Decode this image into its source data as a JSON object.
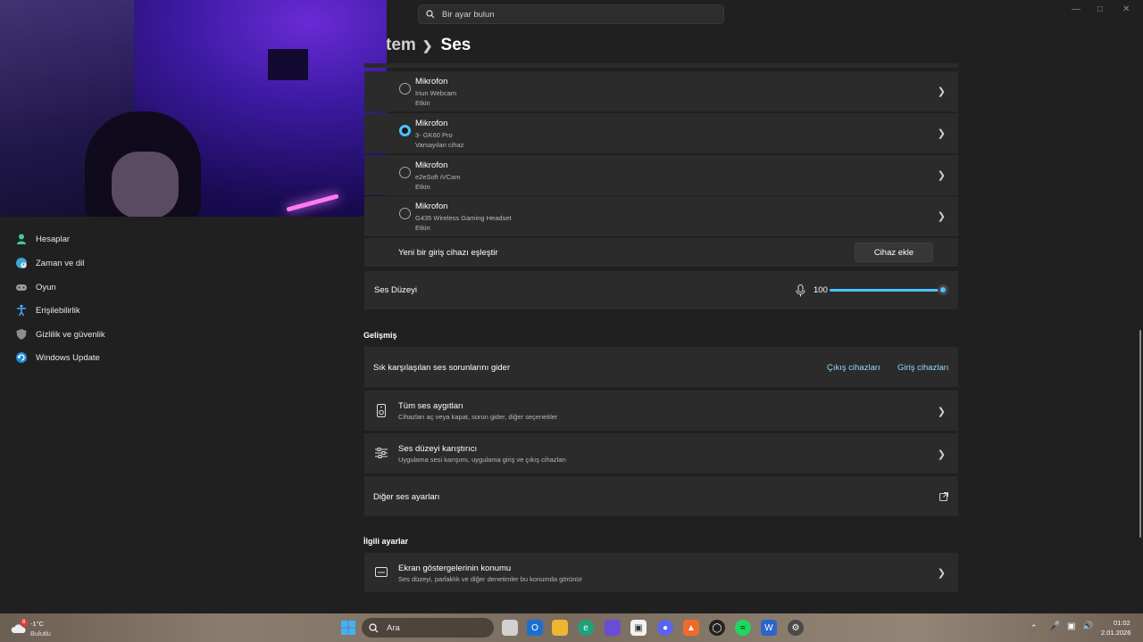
{
  "search": {
    "placeholder": "Bir ayar bulun"
  },
  "breadcrumb": {
    "parent": "tem",
    "current": "Ses"
  },
  "sidebar": {
    "items": [
      {
        "label": "Hesaplar",
        "icon": "account-icon"
      },
      {
        "label": "Zaman ve dil",
        "icon": "globe-clock-icon"
      },
      {
        "label": "Oyun",
        "icon": "gamepad-icon"
      },
      {
        "label": "Erişilebilirlik",
        "icon": "accessibility-icon"
      },
      {
        "label": "Gizlilik ve güvenlik",
        "icon": "shield-icon"
      },
      {
        "label": "Windows Update",
        "icon": "update-icon"
      }
    ]
  },
  "input_devices": [
    {
      "title": "Mikrofon",
      "device": "Iriun Webcam",
      "status": "Etkin",
      "selected": false
    },
    {
      "title": "Mikrofon",
      "device": "3- GK60 Pro",
      "status": "Varsayılan cihaz",
      "selected": true
    },
    {
      "title": "Mikrofon",
      "device": "e2eSoft iVCam",
      "status": "Etkin",
      "selected": false
    },
    {
      "title": "Mikrofon",
      "device": "G435 Wireless Gaming Headset",
      "status": "Etkin",
      "selected": false
    }
  ],
  "pair": {
    "label": "Yeni bir giriş cihazı eşleştir",
    "button": "Cihaz ekle"
  },
  "volume": {
    "label": "Ses Düzeyi",
    "value": "100",
    "level": 1.0
  },
  "advanced": {
    "title": "Gelişmiş",
    "troubleshoot": {
      "label": "Sık karşılaşılan ses sorunlarını gider",
      "output_link": "Çıkış cihazları",
      "input_link": "Giriş cihazları"
    },
    "all_devices": {
      "title": "Tüm ses aygıtları",
      "subtitle": "Cihazları aç veya kapat, sorun gider, diğer seçenekler"
    },
    "mixer": {
      "title": "Ses düzeyi karıştırıcı",
      "subtitle": "Uygulama sesi karışımı, uygulama giriş ve çıkış cihazları"
    },
    "more": {
      "title": "Diğer ses ayarları"
    }
  },
  "related": {
    "title": "İlgili ayarlar",
    "osd": {
      "title": "Ekran göstergelerinin konumu",
      "subtitle": "Ses düzeyi, parlaklık ve diğer denetimler bu konumda görünür"
    }
  },
  "taskbar": {
    "weather_temp": "-1°C",
    "weather_desc": "Bulutlu",
    "weather_badge": "8",
    "search_label": "Ara",
    "time": "01:02",
    "date": "2.01.2026"
  },
  "colors": {
    "accent": "#4cc2ff",
    "background": "#202020",
    "card": "#2b2b2b"
  }
}
